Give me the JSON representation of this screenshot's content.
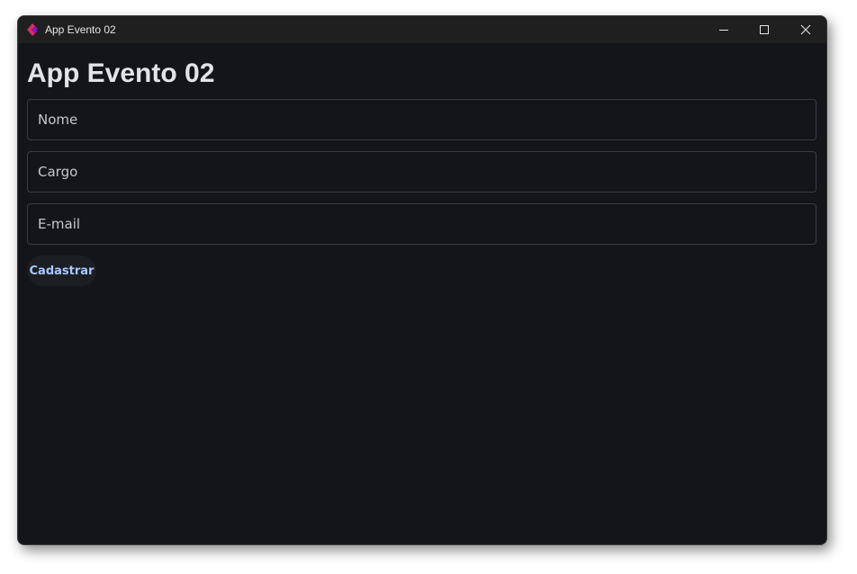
{
  "window": {
    "title": "App Evento 02",
    "controls": {
      "minimize_icon": "minimize-icon",
      "maximize_icon": "maximize-icon",
      "close_icon": "close-icon"
    }
  },
  "page": {
    "heading": "App Evento 02"
  },
  "form": {
    "nome": {
      "placeholder": "Nome",
      "value": ""
    },
    "cargo": {
      "placeholder": "Cargo",
      "value": ""
    },
    "email": {
      "placeholder": "E-mail",
      "value": ""
    },
    "submit_label": "Cadastrar"
  },
  "colors": {
    "background": "#131519",
    "titlebar": "#1f1f1f",
    "accent": "#a9c7ff",
    "field_border": "#3a3d42",
    "app_icon_primary": "#e0286a",
    "app_icon_secondary": "#7a1fb8"
  }
}
